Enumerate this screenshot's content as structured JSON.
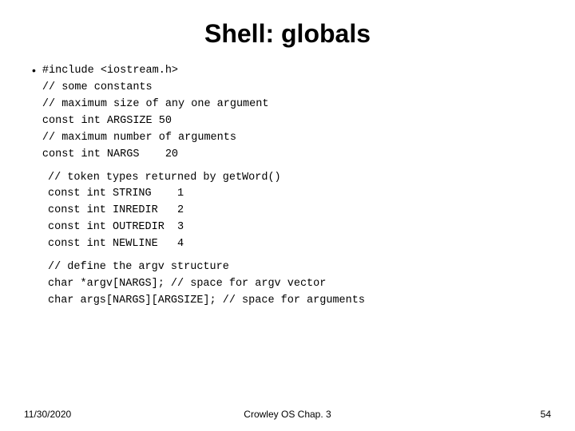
{
  "title": "Shell: globals",
  "code_section1": "#include <iostream.h>\n// some constants\n// maximum size of any one argument\nconst int ARGSIZE 50\n// maximum number of arguments\nconst int NARGS    20",
  "code_section2": "// token types returned by getWord()\nconst int STRING    1\nconst int INREDIR   2\nconst int OUTREDIR  3\nconst int NEWLINE   4",
  "code_section3": "// define the argv structure\nchar *argv[NARGS]; // space for argv vector\nchar args[NARGS][ARGSIZE]; // space for arguments",
  "footer": {
    "left": "11/30/2020",
    "center": "Crowley   OS   Chap. 3",
    "right": "54"
  },
  "bullet": "•"
}
